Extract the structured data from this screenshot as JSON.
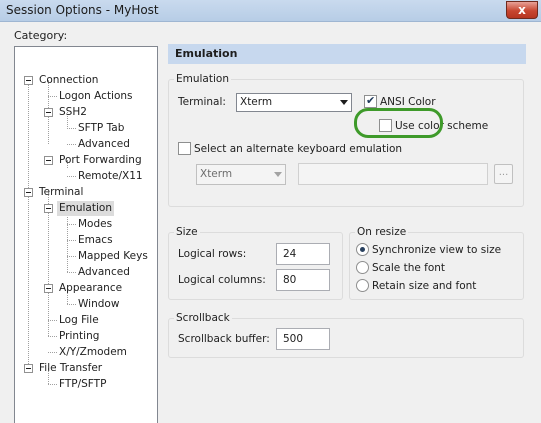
{
  "window": {
    "title": "Session Options - MyHost",
    "close_glyph": "x"
  },
  "category_label": "Category:",
  "tree": {
    "items": [
      {
        "label": "Connection"
      },
      {
        "label": "Logon Actions"
      },
      {
        "label": "SSH2"
      },
      {
        "label": "SFTP Tab"
      },
      {
        "label": "Advanced"
      },
      {
        "label": "Port Forwarding"
      },
      {
        "label": "Remote/X11"
      },
      {
        "label": "Terminal"
      },
      {
        "label": "Emulation",
        "selected": true
      },
      {
        "label": "Modes"
      },
      {
        "label": "Emacs"
      },
      {
        "label": "Mapped Keys"
      },
      {
        "label": "Advanced"
      },
      {
        "label": "Appearance"
      },
      {
        "label": "Window"
      },
      {
        "label": "Log File"
      },
      {
        "label": "Printing"
      },
      {
        "label": "X/Y/Zmodem"
      },
      {
        "label": "File Transfer"
      },
      {
        "label": "FTP/SFTP"
      }
    ]
  },
  "panel": {
    "header": "Emulation",
    "emulation_group": {
      "title": "Emulation",
      "terminal_label": "Terminal:",
      "terminal_value": "Xterm",
      "ansi_color_label": "ANSI Color",
      "ansi_color_checked": true,
      "use_color_scheme_label": "Use color scheme",
      "use_color_scheme_checked": false,
      "alt_keyboard_label": "Select an alternate keyboard emulation",
      "alt_keyboard_checked": false,
      "alt_keyboard_value": "Xterm",
      "alt_keyboard_text": "",
      "browse_label": "..."
    },
    "size_group": {
      "title": "Size",
      "rows_label": "Logical rows:",
      "rows_value": "24",
      "cols_label": "Logical columns:",
      "cols_value": "80"
    },
    "resize_group": {
      "title": "On resize",
      "options": [
        {
          "label": "Synchronize view to size",
          "checked": true
        },
        {
          "label": "Scale the font",
          "checked": false
        },
        {
          "label": "Retain size and font",
          "checked": false
        }
      ]
    },
    "scrollback_group": {
      "title": "Scrollback",
      "buffer_label": "Scrollback buffer:",
      "buffer_value": "500"
    }
  },
  "colors": {
    "highlight_ring": "#3e9a2a",
    "panel_header_bg": "#c7d8ee",
    "titlebar_bg": "#c9daee",
    "close_button": "#c74630"
  },
  "icons": [
    "close-icon",
    "expand-collapse-icon",
    "dropdown-arrow-icon",
    "checkmark-icon"
  ]
}
